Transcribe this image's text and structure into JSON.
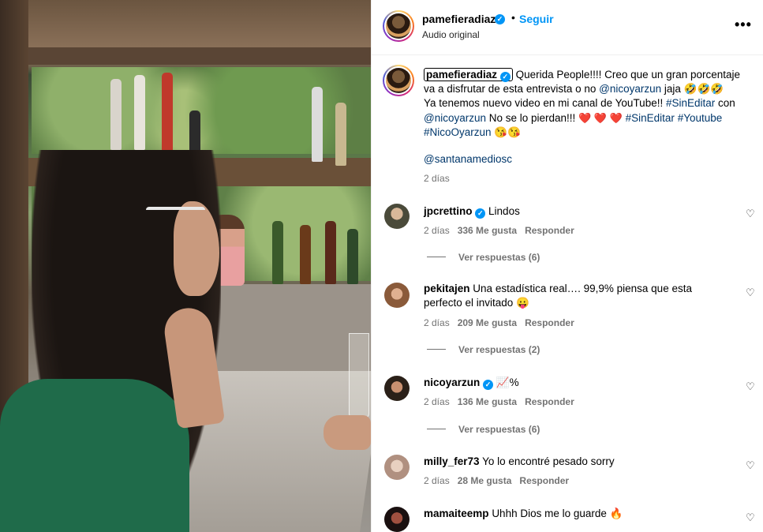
{
  "header": {
    "username": "pamefieradiaz",
    "dot": "•",
    "follow_label": "Seguir",
    "audio": "Audio original",
    "more": "•••"
  },
  "caption": {
    "username": "pamefieradiaz",
    "line1_text": " Querida People!!!! Creo que un gran porcentaje va a disfrutar de esta entrevista o no ",
    "mention1": "@nicoyarzun",
    "line1_tail": " jaja 🤣🤣🤣",
    "line2_text": "Ya tenemos nuevo video en mi canal de YouTube!! ",
    "hashtag1": "#SinEditar",
    "line2_mid": " con ",
    "mention2": "@nicoyarzun",
    "line2_tail": " No se lo pierdan!!! ",
    "hearts": "❤️ ❤️ ❤️",
    "hashtag2": "#SinEditar",
    "hashtag3": "#Youtube",
    "hashtag4": "#NicoOyarzun",
    "end_emoji": "😘😘",
    "tag": "@santanamediosc",
    "time": "2 días"
  },
  "comments": [
    {
      "username": "jpcrettino",
      "verified": true,
      "text": "Lindos",
      "time": "2 días",
      "likes": "336 Me gusta",
      "reply": "Responder",
      "replies": "Ver respuestas (6)"
    },
    {
      "username": "pekitajen",
      "verified": false,
      "text": "Una estadística real…. 99,9% piensa que esta perfecto el invitado 😛",
      "time": "2 días",
      "likes": "209 Me gusta",
      "reply": "Responder",
      "replies": "Ver respuestas (2)"
    },
    {
      "username": "nicoyarzun",
      "verified": true,
      "text": "📈%",
      "time": "2 días",
      "likes": "136 Me gusta",
      "reply": "Responder",
      "replies": "Ver respuestas (6)"
    },
    {
      "username": "milly_fer73",
      "verified": false,
      "text": "Yo lo encontré pesado sorry",
      "time": "2 días",
      "likes": "28 Me gusta",
      "reply": "Responder"
    },
    {
      "username": "mamaiteemp",
      "verified": false,
      "text": "Uhhh Dios me lo guarde 🔥"
    }
  ],
  "icons": {
    "verified": "✓",
    "heart": "♡"
  },
  "colors": {
    "accent": "#0095f6",
    "link": "#00376b",
    "muted": "#737373"
  }
}
